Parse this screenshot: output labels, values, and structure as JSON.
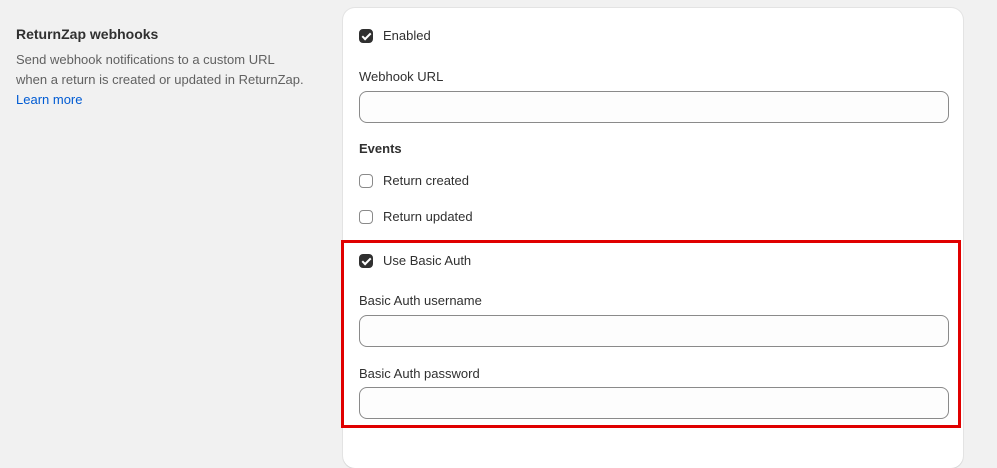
{
  "section": {
    "title": "ReturnZap webhooks",
    "description": "Send webhook notifications to a custom URL when a return is created or updated in ReturnZap.",
    "learn_more": "Learn more"
  },
  "enabled": {
    "label": "Enabled",
    "checked": true
  },
  "webhook_url": {
    "label": "Webhook URL",
    "value": "",
    "placeholder": ""
  },
  "events": {
    "label": "Events",
    "items": [
      {
        "label": "Return created",
        "checked": false
      },
      {
        "label": "Return updated",
        "checked": false
      }
    ]
  },
  "basic_auth": {
    "toggle": {
      "label": "Use Basic Auth",
      "checked": true
    },
    "username": {
      "label": "Basic Auth username",
      "value": ""
    },
    "password": {
      "label": "Basic Auth password",
      "value": ""
    }
  },
  "colors": {
    "highlight": "#e00000",
    "link": "#005bd3",
    "checkbox_checked": "#303030"
  }
}
